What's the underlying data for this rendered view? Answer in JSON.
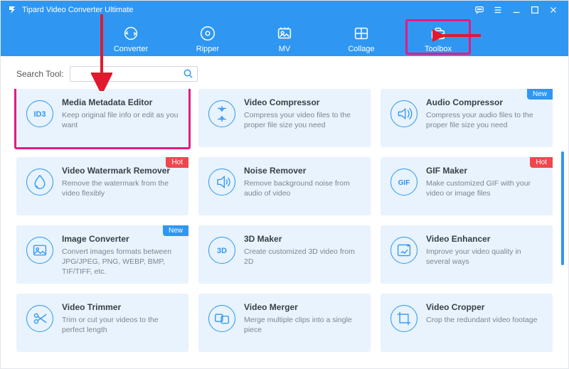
{
  "app": {
    "title": "Tipard Video Converter Ultimate"
  },
  "nav": [
    {
      "id": "converter",
      "label": "Converter"
    },
    {
      "id": "ripper",
      "label": "Ripper"
    },
    {
      "id": "mv",
      "label": "MV"
    },
    {
      "id": "collage",
      "label": "Collage"
    },
    {
      "id": "toolbox",
      "label": "Toolbox",
      "selected": true
    }
  ],
  "search": {
    "label": "Search Tool:",
    "value": ""
  },
  "badges": {
    "hot": "Hot",
    "new": "New"
  },
  "tools": [
    {
      "icon": "id3",
      "title": "Media Metadata Editor",
      "desc": "Keep original file info or edit as you want",
      "highlight": true
    },
    {
      "icon": "compress",
      "title": "Video Compressor",
      "desc": "Compress your video files to the proper file size you need"
    },
    {
      "icon": "audiocomp",
      "title": "Audio Compressor",
      "desc": "Compress your audio files to the proper file size you need",
      "badge": "new"
    },
    {
      "icon": "watermark",
      "title": "Video Watermark Remover",
      "desc": "Remove the watermark from the video flexibly",
      "badge": "hot"
    },
    {
      "icon": "noise",
      "title": "Noise Remover",
      "desc": "Remove background noise from audio of video"
    },
    {
      "icon": "gif",
      "title": "GIF Maker",
      "desc": "Make customized GIF with your video or image files",
      "badge": "hot"
    },
    {
      "icon": "imgconv",
      "title": "Image Converter",
      "desc": "Convert images formats between JPG/JPEG, PNG, WEBP, BMP, TIF/TIFF, etc.",
      "badge": "new"
    },
    {
      "icon": "3d",
      "title": "3D Maker",
      "desc": "Create customized 3D video from 2D"
    },
    {
      "icon": "enhance",
      "title": "Video Enhancer",
      "desc": "Improve your video quality in several ways"
    },
    {
      "icon": "trim",
      "title": "Video Trimmer",
      "desc": "Trim or cut your videos to the perfect length"
    },
    {
      "icon": "merge",
      "title": "Video Merger",
      "desc": "Merge multiple clips into a single piece"
    },
    {
      "icon": "crop",
      "title": "Video Cropper",
      "desc": "Crop the redundant video footage"
    }
  ]
}
